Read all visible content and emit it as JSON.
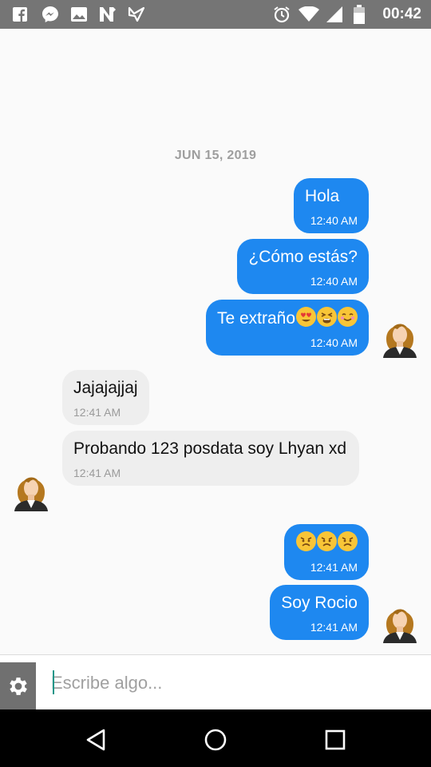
{
  "status_bar": {
    "time": "00:42",
    "left_icons": [
      "facebook-icon",
      "messenger-icon",
      "gallery-icon",
      "n-app-icon",
      "inbox-icon"
    ],
    "right_icons": [
      "alarm-icon",
      "wifi-icon",
      "signal-icon",
      "battery-icon"
    ]
  },
  "chat": {
    "date_label": "JUN 15, 2019",
    "messages": [
      {
        "direction": "out",
        "text": "Hola",
        "time": "12:40 AM"
      },
      {
        "direction": "out",
        "text": "¿Cómo estás?",
        "time": "12:40 AM"
      },
      {
        "direction": "out",
        "text": "Te extraño",
        "emoji": [
          "heart-eyes-emoji",
          "tired-emoji",
          "smiling-emoji"
        ],
        "time": "12:40 AM"
      },
      {
        "direction": "in",
        "text": "Jajajajjaj",
        "time": "12:41 AM"
      },
      {
        "direction": "in",
        "text": "Probando 123 posdata soy Lhyan xd",
        "time": "12:41 AM"
      },
      {
        "direction": "out",
        "text": "",
        "emoji": [
          "angry-emoji",
          "angry-emoji",
          "angry-emoji"
        ],
        "time": "12:41 AM"
      },
      {
        "direction": "out",
        "text": "Soy Rocio",
        "time": "12:41 AM"
      }
    ]
  },
  "composer": {
    "placeholder": "Escribe algo...",
    "value": ""
  },
  "colors": {
    "outgoing_bubble": "#1e88f0",
    "incoming_bubble": "#eeeeee",
    "status_bar": "#757575"
  }
}
